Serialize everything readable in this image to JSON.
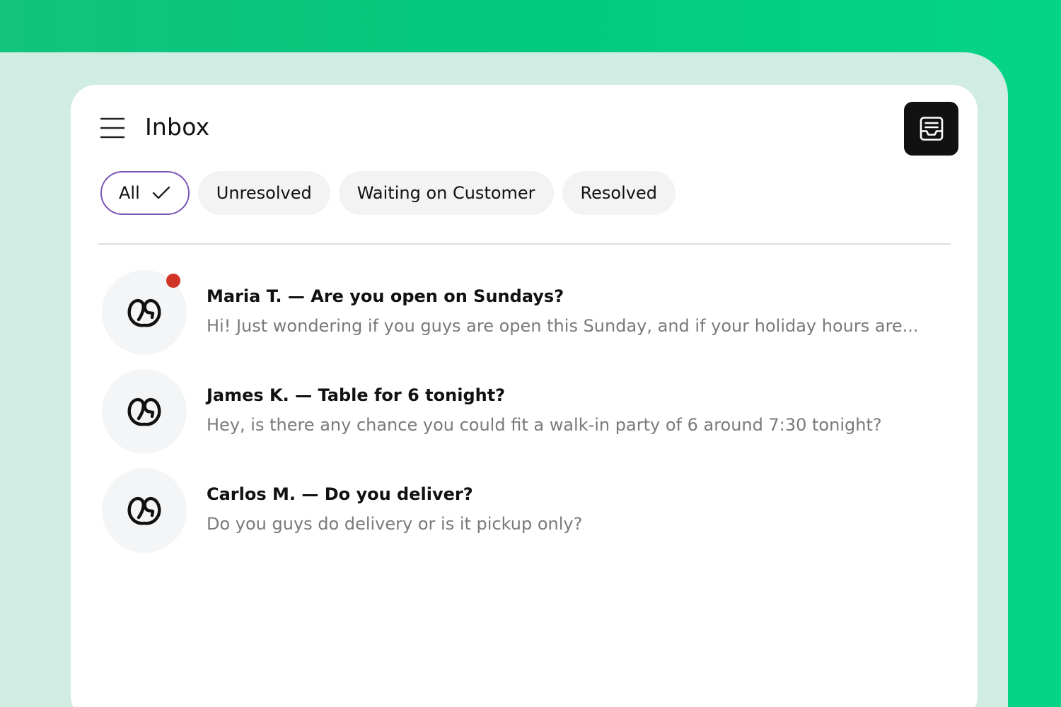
{
  "header": {
    "title": "Inbox"
  },
  "filters": [
    {
      "label": "All",
      "active": true
    },
    {
      "label": "Unresolved",
      "active": false
    },
    {
      "label": "Waiting on Customer",
      "active": false
    },
    {
      "label": "Resolved",
      "active": false
    }
  ],
  "conversations": [
    {
      "title": "Maria T. — Are you open on Sundays?",
      "preview": "Hi! Just wondering if you guys are open this Sunday, and if your holiday hours are...",
      "unread": true
    },
    {
      "title": "James K. — Table for 6 tonight?",
      "preview": "Hey, is there any chance you could fit a walk-in party of 6 around 7:30 tonight?",
      "unread": false
    },
    {
      "title": "Carlos M. — Do you deliver?",
      "preview": "Do you guys do delivery or is it pickup only?",
      "unread": false
    }
  ],
  "icons": {
    "menu": "hamburger-menu-icon",
    "inbox": "inbox-tray-icon",
    "check": "check-icon",
    "avatar": "godaddy-logo-icon"
  },
  "colors": {
    "background_green": "#03c97f",
    "active_chip_border": "#7b54b8",
    "unread_dot": "#cf3426",
    "inbox_button": "#111111"
  }
}
